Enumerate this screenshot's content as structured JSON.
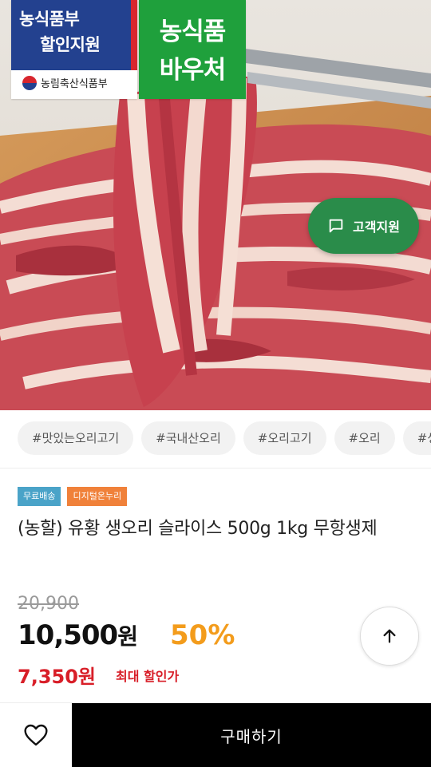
{
  "hero": {
    "gov_badge": {
      "line1": "농식품부",
      "line2": "할인지원",
      "ministry": "농림축산식품부"
    },
    "voucher_badge": {
      "line1": "농식품",
      "line2": "바우처"
    },
    "cs_button": {
      "label": "고객지원",
      "icon": "chat-bubble-icon"
    }
  },
  "hashtags": [
    "#맛있는오리고기",
    "#국내산오리",
    "#오리고기",
    "#오리",
    "#생"
  ],
  "labels": {
    "free_shipping": "무료배송",
    "digital": "디지털온누리"
  },
  "product": {
    "title": "(농할) 유황 생오리 슬라이스 500g 1kg 무항생제",
    "original_price": "20,900",
    "price_number": "10,500",
    "price_unit": "원",
    "discount": "50%",
    "max_discount_price": "7,350원",
    "max_discount_label": "최대 할인가"
  },
  "scroll_top": {
    "icon": "arrow-up-icon"
  },
  "bottom_bar": {
    "wish_icon": "heart-outline-icon",
    "buy_label": "구매하기"
  },
  "colors": {
    "cs_green": "#2a8c4a",
    "voucher_green": "#1fa03c",
    "discount_orange": "#f39c1c",
    "max_price_red": "#d81e28"
  }
}
